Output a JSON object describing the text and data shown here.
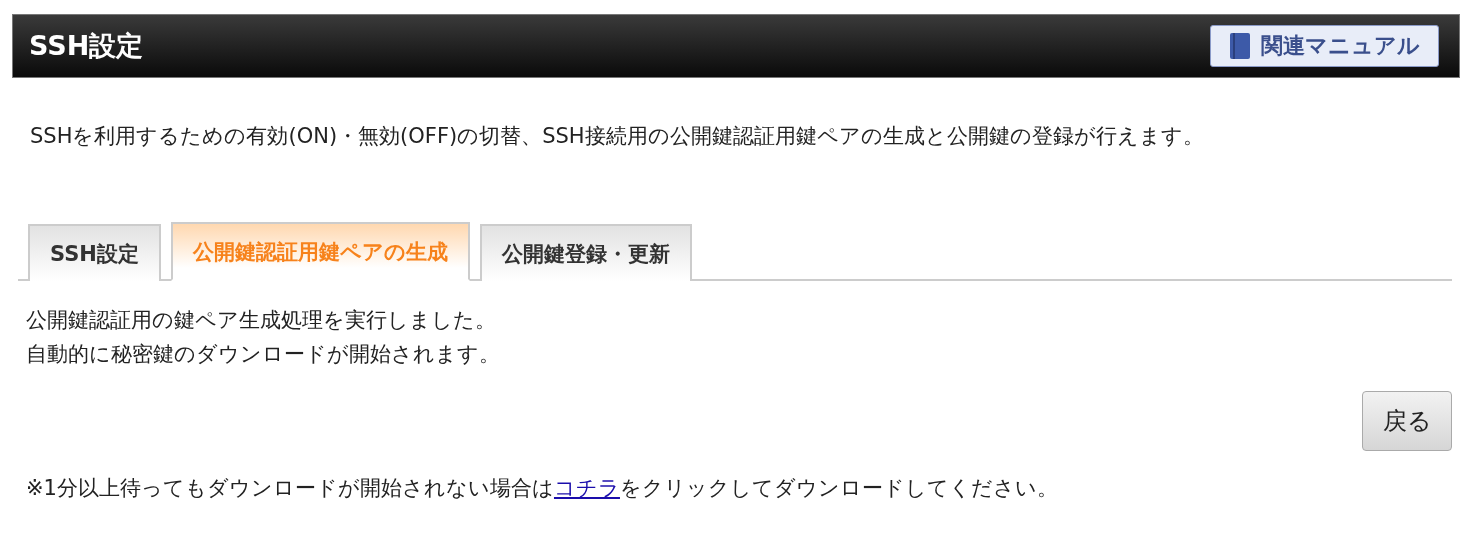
{
  "header": {
    "title": "SSH設定",
    "manual_button": "関連マニュアル"
  },
  "description": "SSHを利用するための有効(ON)・無効(OFF)の切替、SSH接続用の公開鍵認証用鍵ペアの生成と公開鍵の登録が行えます。",
  "tabs": [
    {
      "label": "SSH設定",
      "selected": false
    },
    {
      "label": "公開鍵認証用鍵ペアの生成",
      "selected": true
    },
    {
      "label": "公開鍵登録・更新",
      "selected": false
    }
  ],
  "messages": [
    "公開鍵認証用の鍵ペア生成処理を実行しました。",
    "自動的に秘密鍵のダウンロードが開始されます。"
  ],
  "back_button": "戻る",
  "note": {
    "before": "※1分以上待ってもダウンロードが開始されない場合は",
    "link": "コチラ",
    "after": "をクリックしてダウンロードしてください。"
  }
}
